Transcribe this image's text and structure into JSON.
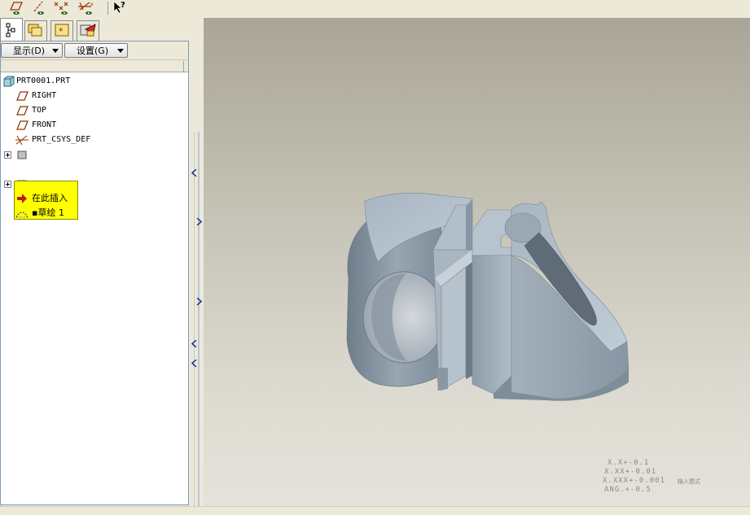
{
  "toolbar": {
    "buttons": [
      "datum-plane-display-icon",
      "datum-axis-display-icon",
      "datum-point-display-icon",
      "coordinate-system-display-icon",
      "context-help-icon"
    ]
  },
  "navigator_tabs": [
    "model-tree-tab",
    "folder-browser-tab",
    "favorites-tab",
    "connections-tab"
  ],
  "model_tree": {
    "display_menu_label": "显示(D)",
    "settings_menu_label": "设置(G)",
    "items": [
      {
        "label": "PRT0001.PRT",
        "icon": "part-icon"
      },
      {
        "label": "RIGHT",
        "icon": "datum-plane-icon"
      },
      {
        "label": "TOP",
        "icon": "datum-plane-icon"
      },
      {
        "label": "FRONT",
        "icon": "datum-plane-icon"
      },
      {
        "label": "PRT_CSYS_DEF",
        "icon": "coordinate-system-icon"
      },
      {
        "label": "",
        "icon": "feature-icon"
      },
      {
        "label": "",
        "icon": "feature-icon"
      },
      {
        "label": "在此插入",
        "icon": "insert-here-arrow-icon"
      },
      {
        "label": "▪草绘 1",
        "icon": "sketch-icon"
      }
    ]
  },
  "viewport": {
    "tolerance_lines": [
      "X.X+-0.1",
      "X.XX+-0.01",
      "X.XXX+-0.001",
      "ANG.+-0.5"
    ],
    "tolerance_note": "输入模式",
    "part_color": "#a4b2bf"
  }
}
